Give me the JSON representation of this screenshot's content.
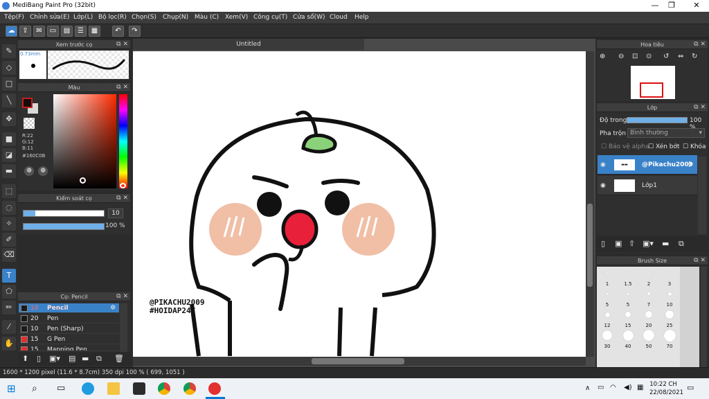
{
  "window": {
    "title": "MediBang Paint Pro (32bit)",
    "minimize": "—",
    "maximize": "❐",
    "close": "✕"
  },
  "menu": [
    "Tệp(F)",
    "Chỉnh sửa(E)",
    "Lớp(L)",
    "Bộ lọc(R)",
    "Chọn(S)",
    "Chụp(N)",
    "Màu (C)",
    "Xem(V)",
    "Công cụ(T)",
    "Cửa sổ(W)",
    "Cloud",
    "Help"
  ],
  "brush_preview": {
    "title": "Xem trước cọ",
    "size": "0.73mm"
  },
  "color_panel": {
    "title": "Màu",
    "r": "R:22",
    "g": "G:12",
    "b": "B:11",
    "hex": "#160C0B",
    "fg": "#160C0B",
    "bg": "#d9d9d9"
  },
  "brush_control": {
    "title": "Kiểm soát cọ",
    "size_value": "10",
    "opacity_value": "100 %",
    "size_fraction": 0.15,
    "opacity_fraction": 1.0
  },
  "brush_list": {
    "title": "Cọ: Pencil",
    "items": [
      {
        "size": "10",
        "name": "Pencil",
        "color": "#1a1a1a",
        "selected": true
      },
      {
        "size": "20",
        "name": "Pen",
        "color": "#1a1a1a",
        "selected": false
      },
      {
        "size": "10",
        "name": "Pen (Sharp)",
        "color": "#1a1a1a",
        "selected": false
      },
      {
        "size": "15",
        "name": "G Pen",
        "color": "#e23030",
        "selected": false
      },
      {
        "size": "15",
        "name": "Mapping Pen",
        "color": "#e23030",
        "selected": false
      }
    ]
  },
  "canvas": {
    "tab": "Untitled",
    "watermark_line1": "@PIKACHU2009",
    "watermark_line2": "#HOIDAP247"
  },
  "navigator": {
    "title": "Hoa tiêu"
  },
  "layers": {
    "title": "Lớp",
    "opacity_label": "Độ trong",
    "opacity_value": "100 %",
    "blend_label": "Pha trộn",
    "blend_value": "Bình thường",
    "protect_alpha": "Bảo vệ alpha",
    "clipping": "Xén bớt",
    "lock": "Khóa",
    "items": [
      {
        "name": "@Pikachu2009",
        "selected": true
      },
      {
        "name": "Lớp1",
        "selected": false
      }
    ]
  },
  "brush_size": {
    "title": "Brush Size",
    "sizes": [
      "1",
      "1.5",
      "2",
      "3",
      "5",
      "5",
      "7",
      "10",
      "12",
      "15",
      "20",
      "25",
      "30",
      "40",
      "50",
      "70"
    ]
  },
  "status": {
    "text": "1600 * 1200 pixel   (11.6 * 8.7cm)   350 dpi   100 %   ( 699, 1051 )"
  },
  "taskbar": {
    "time": "10:22 CH",
    "date": "22/08/2021"
  }
}
